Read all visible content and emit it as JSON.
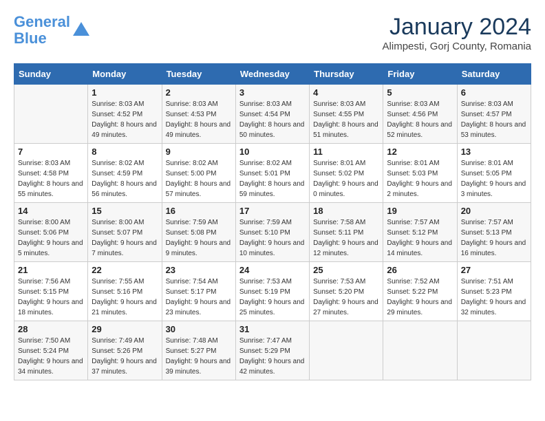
{
  "header": {
    "logo_line1": "General",
    "logo_line2": "Blue",
    "month": "January 2024",
    "location": "Alimpesti, Gorj County, Romania"
  },
  "weekdays": [
    "Sunday",
    "Monday",
    "Tuesday",
    "Wednesday",
    "Thursday",
    "Friday",
    "Saturday"
  ],
  "weeks": [
    [
      {
        "num": "",
        "sunrise": "",
        "sunset": "",
        "daylight": ""
      },
      {
        "num": "1",
        "sunrise": "Sunrise: 8:03 AM",
        "sunset": "Sunset: 4:52 PM",
        "daylight": "Daylight: 8 hours and 49 minutes."
      },
      {
        "num": "2",
        "sunrise": "Sunrise: 8:03 AM",
        "sunset": "Sunset: 4:53 PM",
        "daylight": "Daylight: 8 hours and 49 minutes."
      },
      {
        "num": "3",
        "sunrise": "Sunrise: 8:03 AM",
        "sunset": "Sunset: 4:54 PM",
        "daylight": "Daylight: 8 hours and 50 minutes."
      },
      {
        "num": "4",
        "sunrise": "Sunrise: 8:03 AM",
        "sunset": "Sunset: 4:55 PM",
        "daylight": "Daylight: 8 hours and 51 minutes."
      },
      {
        "num": "5",
        "sunrise": "Sunrise: 8:03 AM",
        "sunset": "Sunset: 4:56 PM",
        "daylight": "Daylight: 8 hours and 52 minutes."
      },
      {
        "num": "6",
        "sunrise": "Sunrise: 8:03 AM",
        "sunset": "Sunset: 4:57 PM",
        "daylight": "Daylight: 8 hours and 53 minutes."
      }
    ],
    [
      {
        "num": "7",
        "sunrise": "Sunrise: 8:03 AM",
        "sunset": "Sunset: 4:58 PM",
        "daylight": "Daylight: 8 hours and 55 minutes."
      },
      {
        "num": "8",
        "sunrise": "Sunrise: 8:02 AM",
        "sunset": "Sunset: 4:59 PM",
        "daylight": "Daylight: 8 hours and 56 minutes."
      },
      {
        "num": "9",
        "sunrise": "Sunrise: 8:02 AM",
        "sunset": "Sunset: 5:00 PM",
        "daylight": "Daylight: 8 hours and 57 minutes."
      },
      {
        "num": "10",
        "sunrise": "Sunrise: 8:02 AM",
        "sunset": "Sunset: 5:01 PM",
        "daylight": "Daylight: 8 hours and 59 minutes."
      },
      {
        "num": "11",
        "sunrise": "Sunrise: 8:01 AM",
        "sunset": "Sunset: 5:02 PM",
        "daylight": "Daylight: 9 hours and 0 minutes."
      },
      {
        "num": "12",
        "sunrise": "Sunrise: 8:01 AM",
        "sunset": "Sunset: 5:03 PM",
        "daylight": "Daylight: 9 hours and 2 minutes."
      },
      {
        "num": "13",
        "sunrise": "Sunrise: 8:01 AM",
        "sunset": "Sunset: 5:05 PM",
        "daylight": "Daylight: 9 hours and 3 minutes."
      }
    ],
    [
      {
        "num": "14",
        "sunrise": "Sunrise: 8:00 AM",
        "sunset": "Sunset: 5:06 PM",
        "daylight": "Daylight: 9 hours and 5 minutes."
      },
      {
        "num": "15",
        "sunrise": "Sunrise: 8:00 AM",
        "sunset": "Sunset: 5:07 PM",
        "daylight": "Daylight: 9 hours and 7 minutes."
      },
      {
        "num": "16",
        "sunrise": "Sunrise: 7:59 AM",
        "sunset": "Sunset: 5:08 PM",
        "daylight": "Daylight: 9 hours and 9 minutes."
      },
      {
        "num": "17",
        "sunrise": "Sunrise: 7:59 AM",
        "sunset": "Sunset: 5:10 PM",
        "daylight": "Daylight: 9 hours and 10 minutes."
      },
      {
        "num": "18",
        "sunrise": "Sunrise: 7:58 AM",
        "sunset": "Sunset: 5:11 PM",
        "daylight": "Daylight: 9 hours and 12 minutes."
      },
      {
        "num": "19",
        "sunrise": "Sunrise: 7:57 AM",
        "sunset": "Sunset: 5:12 PM",
        "daylight": "Daylight: 9 hours and 14 minutes."
      },
      {
        "num": "20",
        "sunrise": "Sunrise: 7:57 AM",
        "sunset": "Sunset: 5:13 PM",
        "daylight": "Daylight: 9 hours and 16 minutes."
      }
    ],
    [
      {
        "num": "21",
        "sunrise": "Sunrise: 7:56 AM",
        "sunset": "Sunset: 5:15 PM",
        "daylight": "Daylight: 9 hours and 18 minutes."
      },
      {
        "num": "22",
        "sunrise": "Sunrise: 7:55 AM",
        "sunset": "Sunset: 5:16 PM",
        "daylight": "Daylight: 9 hours and 21 minutes."
      },
      {
        "num": "23",
        "sunrise": "Sunrise: 7:54 AM",
        "sunset": "Sunset: 5:17 PM",
        "daylight": "Daylight: 9 hours and 23 minutes."
      },
      {
        "num": "24",
        "sunrise": "Sunrise: 7:53 AM",
        "sunset": "Sunset: 5:19 PM",
        "daylight": "Daylight: 9 hours and 25 minutes."
      },
      {
        "num": "25",
        "sunrise": "Sunrise: 7:53 AM",
        "sunset": "Sunset: 5:20 PM",
        "daylight": "Daylight: 9 hours and 27 minutes."
      },
      {
        "num": "26",
        "sunrise": "Sunrise: 7:52 AM",
        "sunset": "Sunset: 5:22 PM",
        "daylight": "Daylight: 9 hours and 29 minutes."
      },
      {
        "num": "27",
        "sunrise": "Sunrise: 7:51 AM",
        "sunset": "Sunset: 5:23 PM",
        "daylight": "Daylight: 9 hours and 32 minutes."
      }
    ],
    [
      {
        "num": "28",
        "sunrise": "Sunrise: 7:50 AM",
        "sunset": "Sunset: 5:24 PM",
        "daylight": "Daylight: 9 hours and 34 minutes."
      },
      {
        "num": "29",
        "sunrise": "Sunrise: 7:49 AM",
        "sunset": "Sunset: 5:26 PM",
        "daylight": "Daylight: 9 hours and 37 minutes."
      },
      {
        "num": "30",
        "sunrise": "Sunrise: 7:48 AM",
        "sunset": "Sunset: 5:27 PM",
        "daylight": "Daylight: 9 hours and 39 minutes."
      },
      {
        "num": "31",
        "sunrise": "Sunrise: 7:47 AM",
        "sunset": "Sunset: 5:29 PM",
        "daylight": "Daylight: 9 hours and 42 minutes."
      },
      {
        "num": "",
        "sunrise": "",
        "sunset": "",
        "daylight": ""
      },
      {
        "num": "",
        "sunrise": "",
        "sunset": "",
        "daylight": ""
      },
      {
        "num": "",
        "sunrise": "",
        "sunset": "",
        "daylight": ""
      }
    ]
  ]
}
